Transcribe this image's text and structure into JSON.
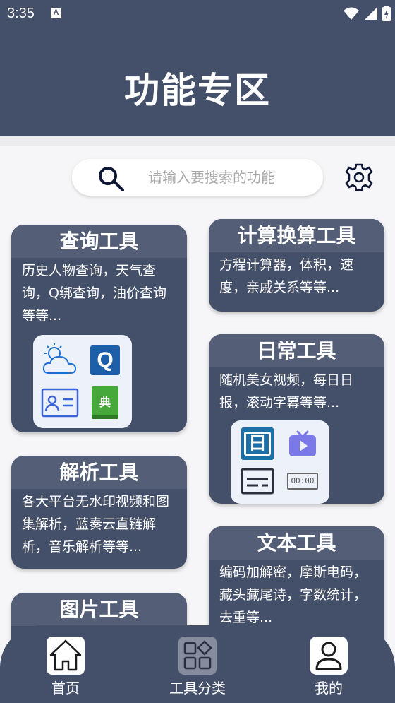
{
  "status": {
    "time": "3:35",
    "notif": "A"
  },
  "header": {
    "title": "功能专区"
  },
  "search": {
    "placeholder": "请输入要搜索的功能"
  },
  "cards": {
    "query": {
      "title": "查询工具",
      "desc": "历史人物查询，天气查询，Q绑查询，油价查询等等...",
      "ghost": ""
    },
    "calc": {
      "title": "计算换算工具",
      "desc": "方程计算器，体积，速度，亲戚关系等等...",
      "ghost": ""
    },
    "daily": {
      "title": "日常工具",
      "desc": "随机美女视频，每日日报，滚动字幕等等...",
      "ghost": ""
    },
    "parse": {
      "title": "解析工具",
      "desc": "各大平台无水印视频和图集解析，蓝奏云直链解析，音乐解析等等...",
      "ghost": ""
    },
    "text": {
      "title": "文本工具",
      "desc": "编码加解密，摩斯电码，藏头藏尾诗，字数统计，去重等...",
      "ghost": ""
    },
    "image": {
      "title": "图片工具",
      "ghost": ""
    }
  },
  "icons": {
    "q_letter": "Q",
    "dict_char": "典",
    "calendar_char": "日",
    "timer_text": "00:00"
  },
  "nav": {
    "home": "首页",
    "categories": "工具分类",
    "mine": "我的"
  },
  "colors": {
    "primary": "#444f69",
    "card_head": "#545e76",
    "accent_blue": "#1e5fa9",
    "accent_green": "#46a83a",
    "accent_purple": "#7b79e8"
  }
}
